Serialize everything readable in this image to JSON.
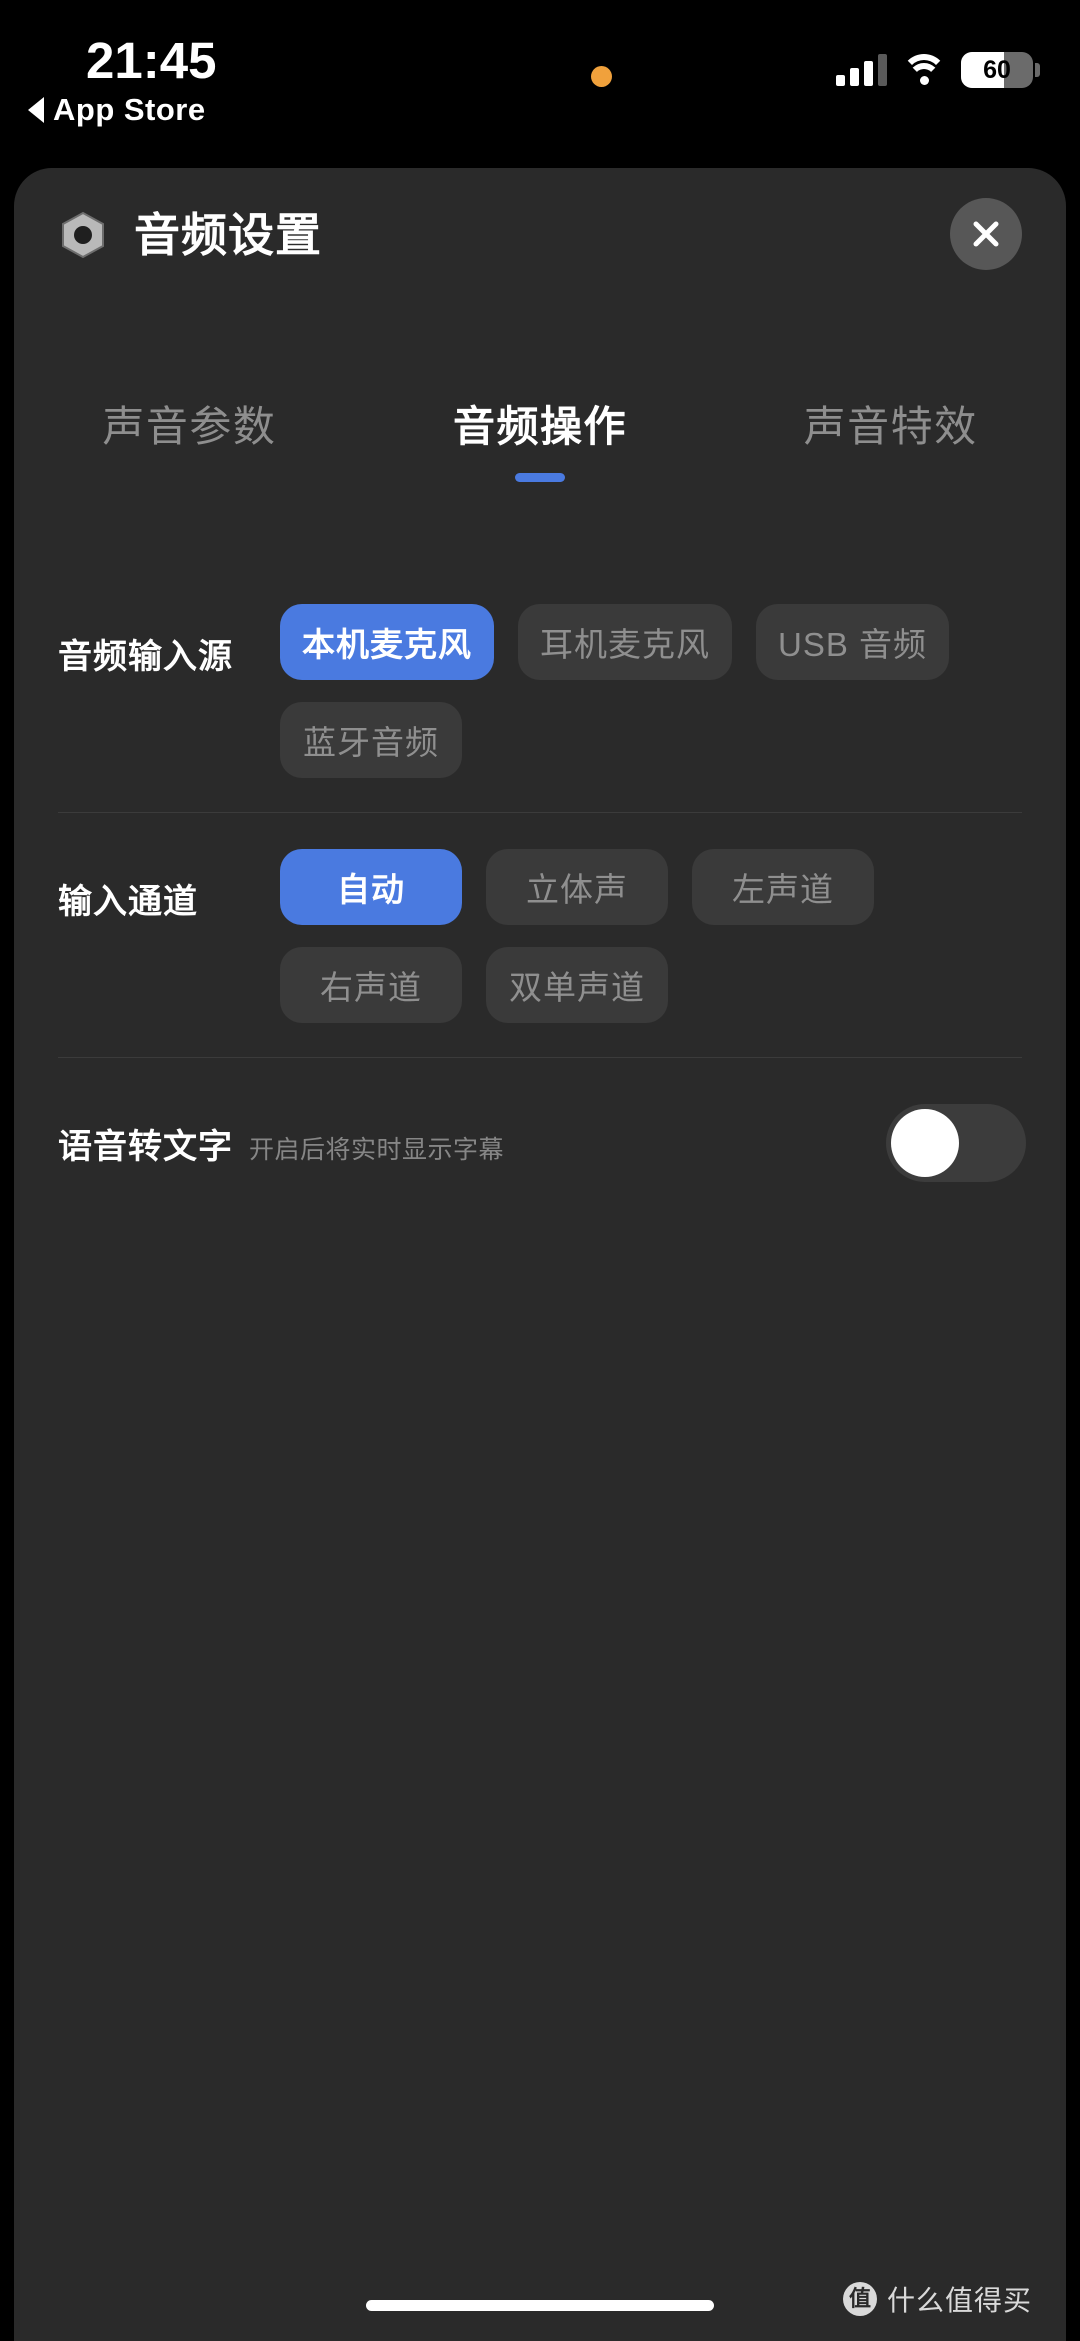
{
  "statusbar": {
    "time": "21:45",
    "back_label": "App Store",
    "back_icon": "caret-left-icon",
    "recording_indicator": "recording-dot",
    "signal_icon": "cellular-signal-icon",
    "wifi_icon": "wifi-icon",
    "battery_percent": "60",
    "battery_fill": 60
  },
  "sheet": {
    "icon": "hex-nut-icon",
    "title": "音频设置",
    "close_label": "×",
    "tabs": [
      {
        "label": "声音参数",
        "active": false
      },
      {
        "label": "音频操作",
        "active": true
      },
      {
        "label": "声音特效",
        "active": false
      }
    ],
    "rows": [
      {
        "label": "音频输入源",
        "options": [
          {
            "label": "本机麦克风",
            "selected": true
          },
          {
            "label": "耳机麦克风",
            "selected": false
          },
          {
            "label": "USB 音频",
            "selected": false
          },
          {
            "label": "蓝牙音频",
            "selected": false
          }
        ]
      },
      {
        "label": "输入通道",
        "options": [
          {
            "label": "自动",
            "selected": true
          },
          {
            "label": "立体声",
            "selected": false
          },
          {
            "label": "左声道",
            "selected": false
          },
          {
            "label": "右声道",
            "selected": false
          },
          {
            "label": "双单声道",
            "selected": false
          }
        ]
      }
    ],
    "toggle_row": {
      "title": "语音转文字",
      "hint": "开启后将实时显示字幕",
      "enabled": false
    }
  },
  "footer": {
    "watermark_logo": "值",
    "watermark_text": "什么值得买"
  },
  "colors": {
    "accent": "#4a7ae0",
    "sheet_bg": "#2a2a2a",
    "chip_bg": "#3a3a3a",
    "chip_text": "#8f8f8f",
    "status_bg": "#000000",
    "recording_dot": "#f0a13c"
  }
}
